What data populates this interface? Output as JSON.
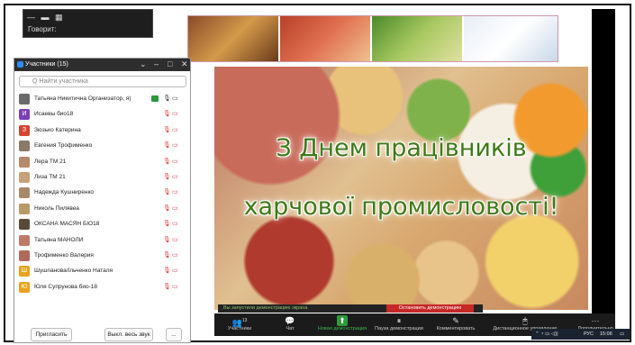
{
  "window": {
    "speaking_label": "Говорит:"
  },
  "participants_panel": {
    "title": "Участники (15)",
    "search_placeholder": "Q Найти участника",
    "participants": [
      {
        "name": "Татьяна Никитична Организатор, я)",
        "initial": "",
        "color": "#6b6b6b",
        "host": true
      },
      {
        "name": "Исаевы био18",
        "initial": "И",
        "color": "#7b3fb8"
      },
      {
        "name": "Зюзько Катерина",
        "initial": "З",
        "color": "#d2452f"
      },
      {
        "name": "Евгения Трофименко",
        "initial": "",
        "color": "#8a7868"
      },
      {
        "name": "Лера ТМ 21",
        "initial": "",
        "color": "#b58a6b"
      },
      {
        "name": "Лиза ТМ 21",
        "initial": "",
        "color": "#c9a07a"
      },
      {
        "name": "Надежда Кушниренко",
        "initial": "",
        "color": "#a8886a"
      },
      {
        "name": "Николь Пилявеа",
        "initial": "",
        "color": "#b89a6a"
      },
      {
        "name": "ОКСАНА МАСЯН БІО18",
        "initial": "",
        "color": "#5a4a3a"
      },
      {
        "name": "Татьяна МАНОЛИ",
        "initial": "",
        "color": "#c07a6a"
      },
      {
        "name": "Трофименко Валерия",
        "initial": "",
        "color": "#b06a5a"
      },
      {
        "name": "Шушпанова/Ільченко Наталя",
        "initial": "Ш",
        "color": "#e8a21b"
      },
      {
        "name": "Юля Супрунова био-18",
        "initial": "Ю",
        "color": "#e8a21b"
      }
    ],
    "invite_label": "Пригласить",
    "mute_all_label": "Выкл. весь звук",
    "more_label": "..."
  },
  "slide": {
    "line1": "З Днем працівників",
    "line2": "харчової промисловості!"
  },
  "share_bar": {
    "message": "Вы запустили демонстрацию экрана",
    "stop_label": "Остановить демонстрацию"
  },
  "toolbar": {
    "participants_count": "13",
    "items": [
      {
        "label": "Участники",
        "icon": "👥"
      },
      {
        "label": "Чат",
        "icon": "💬"
      },
      {
        "label": "Новая демонстрация",
        "icon": "⬆"
      },
      {
        "label": "Пауза демонстрации",
        "icon": "⏸"
      },
      {
        "label": "Комментировать",
        "icon": "✎"
      },
      {
        "label": "Дистанционное управление",
        "icon": "🖱"
      },
      {
        "label": "Дополнительно",
        "icon": "···"
      }
    ]
  },
  "taskbar": {
    "lang": "РУС",
    "time": "15:06"
  }
}
